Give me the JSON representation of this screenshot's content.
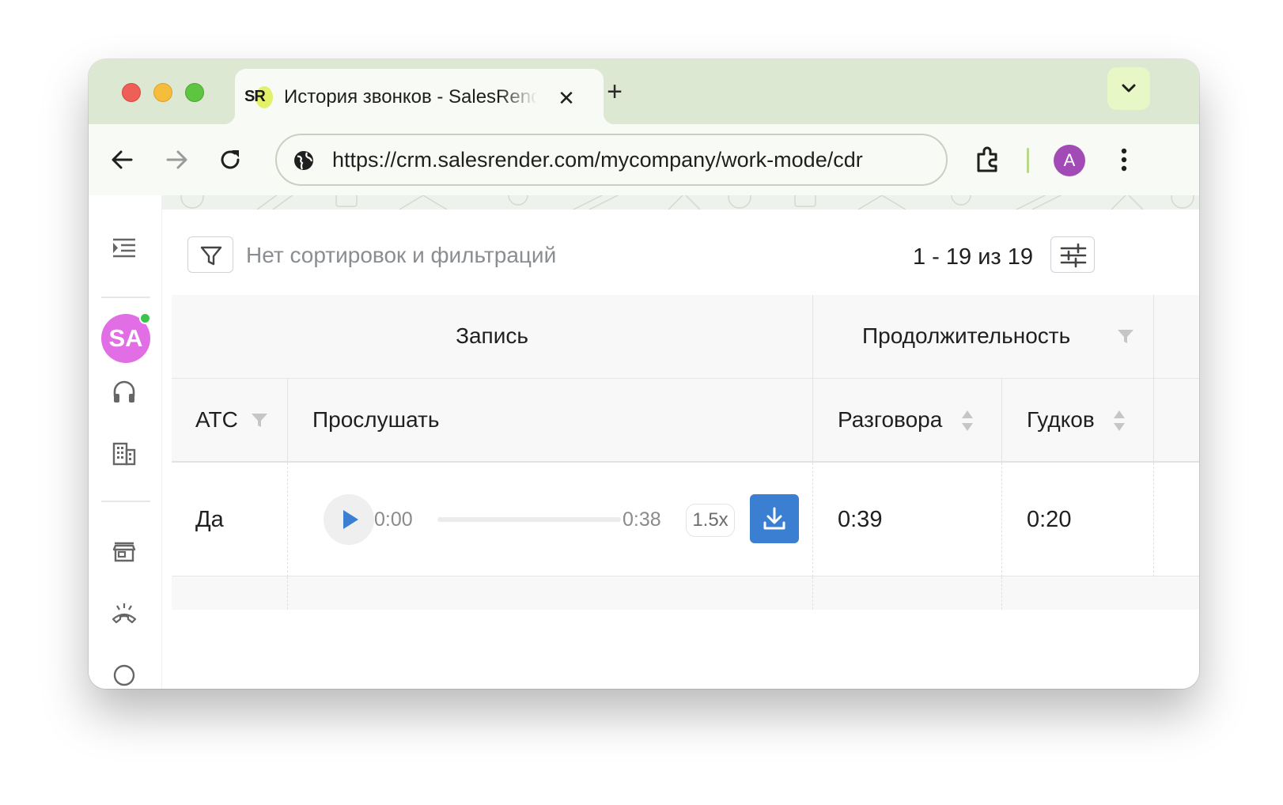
{
  "browser": {
    "tab": {
      "favicon_text": "SR",
      "title": "История звонков - SalesRender"
    },
    "url": "https://crm.salesrender.com/mycompany/work-mode/cdr",
    "profile_initial": "A"
  },
  "sidebar": {
    "user_initials": "SA",
    "user_online": true
  },
  "toolbar": {
    "filter_placeholder": "Нет сортировок и фильтраций",
    "pagination": "1 - 19 из 19"
  },
  "table": {
    "group_headers": {
      "recording": "Запись",
      "duration": "Продолжительность"
    },
    "columns": {
      "pbx": "АТС",
      "listen": "Прослушать",
      "talk": "Разговора",
      "ring": "Гудков"
    },
    "rows": [
      {
        "pbx": "Да",
        "player": {
          "current_time": "0:00",
          "total_time": "0:38",
          "speed": "1.5x",
          "progress": 0
        },
        "talk": "0:39",
        "ring": "0:20"
      }
    ]
  },
  "colors": {
    "accent": "#3a7fd1",
    "tabstrip": "#dce8d1",
    "avatar_user": "#e26ee5",
    "avatar_profile": "#a24ab6",
    "online": "#3cc44c"
  }
}
